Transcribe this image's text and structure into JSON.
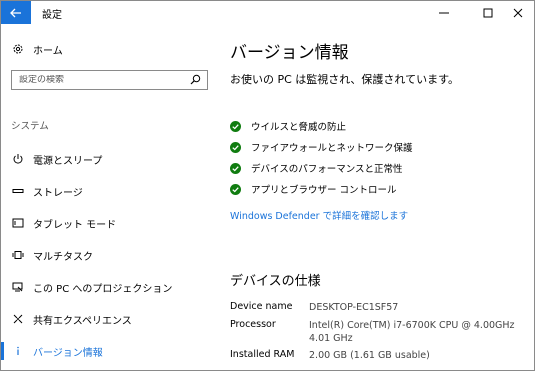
{
  "window": {
    "title": "設定"
  },
  "sidebar": {
    "home_label": "ホーム",
    "search_placeholder": "設定の検索",
    "section_label": "システム",
    "items": [
      {
        "label": "電源とスリープ",
        "icon": "power-icon"
      },
      {
        "label": "ストレージ",
        "icon": "storage-icon"
      },
      {
        "label": "タブレット モード",
        "icon": "tablet-mode-icon"
      },
      {
        "label": "マルチタスク",
        "icon": "multitasking-icon"
      },
      {
        "label": "この PC へのプロジェクション",
        "icon": "projection-icon"
      },
      {
        "label": "共有エクスペリエンス",
        "icon": "shared-experiences-icon"
      },
      {
        "label": "バージョン情報",
        "icon": "info-icon",
        "selected": true
      }
    ]
  },
  "main": {
    "heading": "バージョン情報",
    "status_text": "お使いの PC は監視され、保護されています。",
    "checks": [
      "ウイルスと脅威の防止",
      "ファイアウォールとネットワーク保護",
      "デバイスのパフォーマンスと正常性",
      "アプリとブラウザー コントロール"
    ],
    "defender_link": "Windows Defender で詳細を確認します",
    "specs_heading": "デバイスの仕様",
    "specs": [
      {
        "label": "Device name",
        "value": "DESKTOP-EC1SF57"
      },
      {
        "label": "Processor",
        "value": "Intel(R) Core(TM) i7-6700K CPU @ 4.00GHz 4.01 GHz"
      },
      {
        "label": "Installed RAM",
        "value": "2.00 GB (1.61 GB usable)"
      }
    ]
  },
  "colors": {
    "accent": "#1a73d9",
    "check_green": "#107c10"
  }
}
